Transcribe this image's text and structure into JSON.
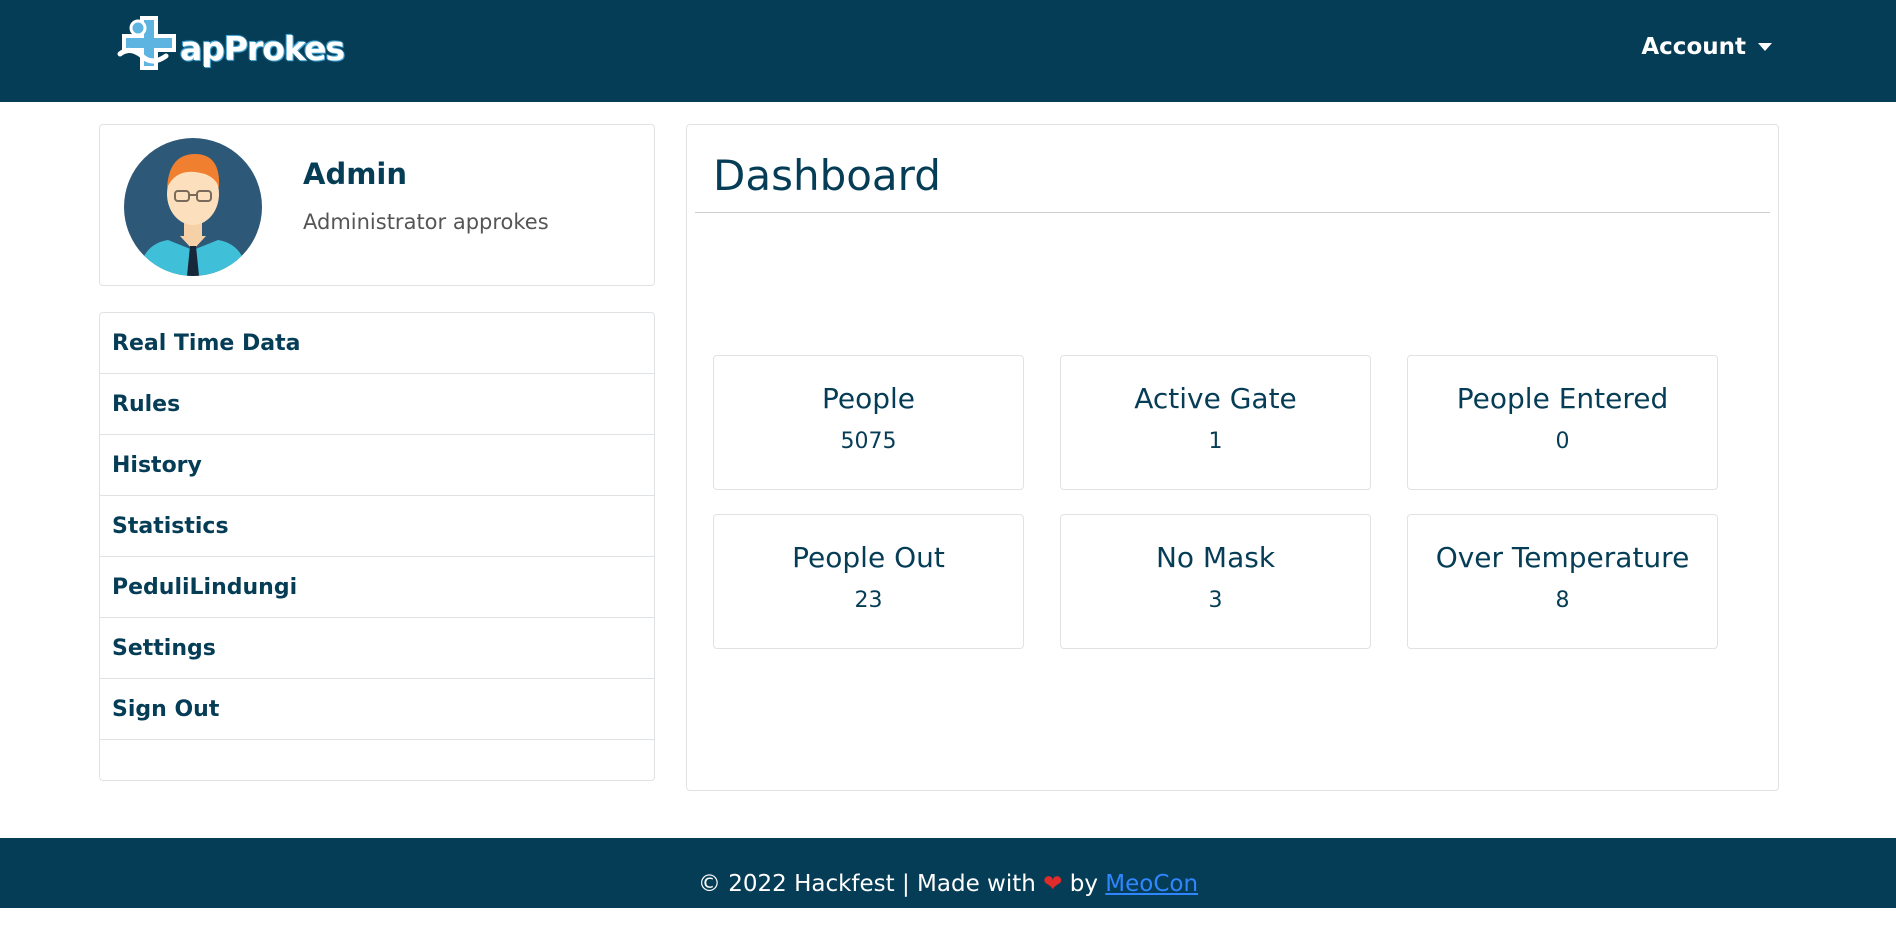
{
  "header": {
    "logo_text": "apProkes",
    "account_label": "Account"
  },
  "profile": {
    "name": "Admin",
    "role": "Administrator approkes"
  },
  "sidebar": {
    "items": [
      {
        "label": "Real Time Data"
      },
      {
        "label": "Rules"
      },
      {
        "label": "History"
      },
      {
        "label": "Statistics"
      },
      {
        "label": "PeduliLindungi"
      },
      {
        "label": "Settings"
      },
      {
        "label": "Sign Out"
      }
    ]
  },
  "dashboard": {
    "title": "Dashboard",
    "stats": [
      {
        "label": "People",
        "value": "5075"
      },
      {
        "label": "Active Gate",
        "value": "1"
      },
      {
        "label": "People Entered",
        "value": "0"
      },
      {
        "label": "People Out",
        "value": "23"
      },
      {
        "label": "No Mask",
        "value": "3"
      },
      {
        "label": "Over Temperature",
        "value": "8"
      }
    ]
  },
  "footer": {
    "text_before": "© 2022 Hackfest | Made with",
    "heart": "❤",
    "text_by": "by",
    "link_text": "MeoCon"
  },
  "colors": {
    "primary": "#063d56",
    "link": "#2f86ff",
    "heart": "#e02b2b"
  }
}
